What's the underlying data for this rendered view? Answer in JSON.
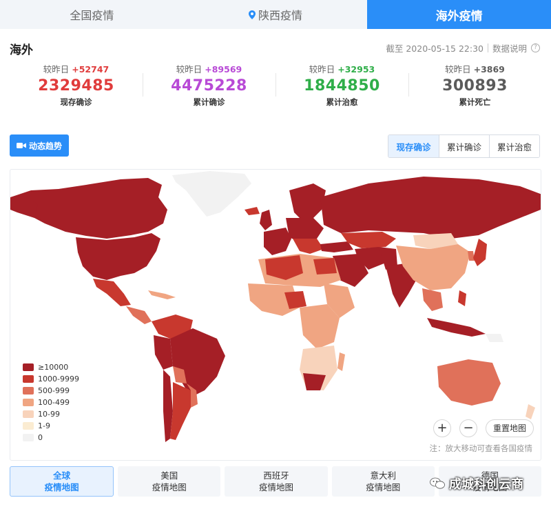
{
  "tabs": [
    {
      "label": "全国疫情"
    },
    {
      "label": "陕西疫情",
      "icon": "location-pin-icon"
    },
    {
      "label": "海外疫情",
      "active": true
    }
  ],
  "header": {
    "title": "海外",
    "as_of": "截至 2020-05-15 22:30",
    "data_note": "数据说明",
    "help_icon": "?"
  },
  "stats": [
    {
      "delta_label": "较昨日",
      "delta": "+52747",
      "value": "2329485",
      "label": "现存确诊",
      "color": "#e03c3c"
    },
    {
      "delta_label": "较昨日",
      "delta": "+89569",
      "value": "4475228",
      "label": "累计确诊",
      "color": "#b84ad6"
    },
    {
      "delta_label": "较昨日",
      "delta": "+32953",
      "value": "1844850",
      "label": "累计治愈",
      "color": "#2fae49"
    },
    {
      "delta_label": "较昨日",
      "delta": "+3869",
      "value": "300893",
      "label": "累计死亡",
      "color": "#5b5b5b"
    }
  ],
  "controls": {
    "trend_button": "动态趋势",
    "segments": [
      "现存确诊",
      "累计确诊",
      "累计治愈"
    ],
    "active_segment": "现存确诊"
  },
  "map": {
    "legend": [
      {
        "label": "≥10000",
        "color": "#a51f26"
      },
      {
        "label": "1000-9999",
        "color": "#c8382e"
      },
      {
        "label": "500-999",
        "color": "#e0715a"
      },
      {
        "label": "100-499",
        "color": "#f0a582"
      },
      {
        "label": "10-99",
        "color": "#f8d3bb"
      },
      {
        "label": "1-9",
        "color": "#fbecd2"
      },
      {
        "label": "0",
        "color": "#f2f2f2"
      }
    ],
    "zoom_in": "+",
    "zoom_out": "−",
    "reset": "重置地图",
    "note": "注：放大移动可查看各国疫情"
  },
  "bottom_tabs": [
    {
      "line1": "全球",
      "line2": "疫情地图",
      "active": true
    },
    {
      "line1": "美国",
      "line2": "疫情地图"
    },
    {
      "line1": "西班牙",
      "line2": "疫情地图"
    },
    {
      "line1": "意大利",
      "line2": "疫情地图"
    },
    {
      "line1": "德国",
      "line2": "疫情地图"
    }
  ],
  "watermark": "成城科创云商"
}
